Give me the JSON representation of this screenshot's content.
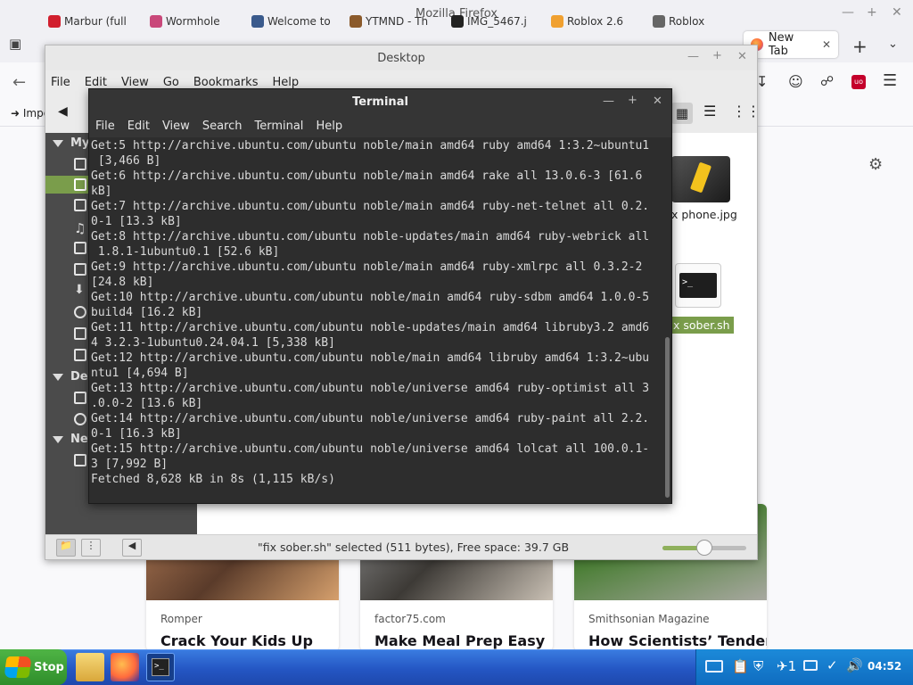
{
  "firefox": {
    "window_title": "Mozilla Firefox",
    "tabs": [
      {
        "label": "Marbur (full",
        "color": "#d11f2e"
      },
      {
        "label": "Wormhole",
        "color": "#c9487a"
      },
      {
        "label": "Welcome to",
        "color": "#3a5a8c"
      },
      {
        "label": "YTMND - Th",
        "color": "#8b5a2b"
      },
      {
        "label": "IMG_5467.j",
        "color": "#222222"
      },
      {
        "label": "Roblox 2.6",
        "color": "#f0a030"
      },
      {
        "label": "Roblox",
        "color": "#666666"
      }
    ],
    "active_tab": "New Tab",
    "bookmark_import": "Import",
    "cards": [
      {
        "source": "Romper",
        "title": "Crack Your Kids Up"
      },
      {
        "source": "factor75.com",
        "title": "Make Meal Prep Easy"
      },
      {
        "source": "Smithsonian Magazine",
        "title": "How Scientists’ Tender"
      }
    ]
  },
  "file_manager": {
    "title": "Desktop",
    "menu": [
      "File",
      "Edit",
      "View",
      "Go",
      "Bookmarks",
      "Help"
    ],
    "sidebar_sections": [
      {
        "label": "My"
      },
      {
        "label": "Dev"
      },
      {
        "label": "Net"
      }
    ],
    "files": [
      {
        "name": "x phone.jpg"
      },
      {
        "name": "x sober.sh"
      }
    ],
    "status_text": "\"fix sober.sh\" selected (511 bytes), Free space: 39.7 GB",
    "zoom_fraction": 0.5
  },
  "terminal": {
    "title": "Terminal",
    "menu": [
      "File",
      "Edit",
      "View",
      "Search",
      "Terminal",
      "Help"
    ],
    "lines": [
      "Get:5 http://archive.ubuntu.com/ubuntu noble/main amd64 ruby amd64 1:3.2~ubuntu1",
      " [3,466 B]",
      "Get:6 http://archive.ubuntu.com/ubuntu noble/main amd64 rake all 13.0.6-3 [61.6",
      "kB]",
      "Get:7 http://archive.ubuntu.com/ubuntu noble/main amd64 ruby-net-telnet all 0.2.",
      "0-1 [13.3 kB]",
      "Get:8 http://archive.ubuntu.com/ubuntu noble-updates/main amd64 ruby-webrick all",
      " 1.8.1-1ubuntu0.1 [52.6 kB]",
      "Get:9 http://archive.ubuntu.com/ubuntu noble/main amd64 ruby-xmlrpc all 0.3.2-2",
      "[24.8 kB]",
      "Get:10 http://archive.ubuntu.com/ubuntu noble/main amd64 ruby-sdbm amd64 1.0.0-5",
      "build4 [16.2 kB]",
      "Get:11 http://archive.ubuntu.com/ubuntu noble-updates/main amd64 libruby3.2 amd6",
      "4 3.2.3-1ubuntu0.24.04.1 [5,338 kB]",
      "Get:12 http://archive.ubuntu.com/ubuntu noble/main amd64 libruby amd64 1:3.2~ubu",
      "ntu1 [4,694 B]",
      "Get:13 http://archive.ubuntu.com/ubuntu noble/universe amd64 ruby-optimist all 3",
      ".0.0-2 [13.6 kB]",
      "Get:14 http://archive.ubuntu.com/ubuntu noble/universe amd64 ruby-paint all 2.2.",
      "0-1 [16.3 kB]",
      "Get:15 http://archive.ubuntu.com/ubuntu noble/universe amd64 lolcat all 100.0.1-",
      "3 [7,992 B]",
      "Fetched 8,628 kB in 8s (1,115 kB/s)"
    ]
  },
  "taskbar": {
    "start_label": "Stop",
    "tray_badge": "1",
    "clock": "04:52"
  }
}
